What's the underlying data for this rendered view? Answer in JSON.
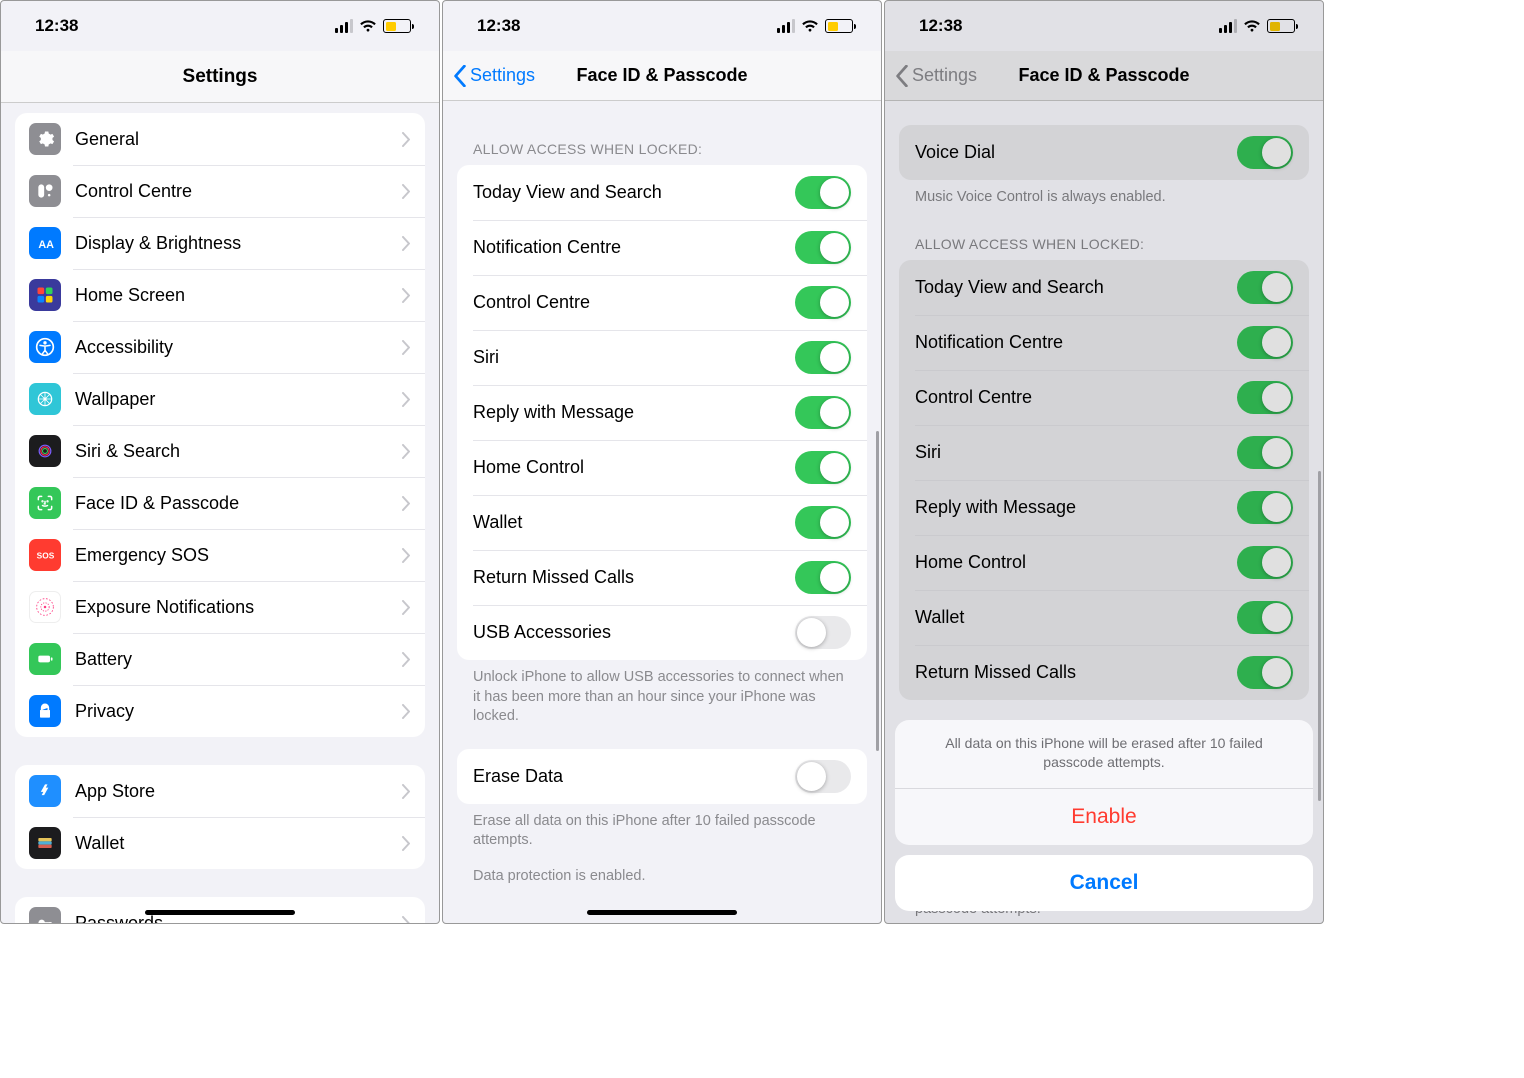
{
  "status": {
    "time": "12:38"
  },
  "screen1": {
    "title": "Settings",
    "group1": [
      {
        "label": "General",
        "name": "general",
        "color": "#8e8e93"
      },
      {
        "label": "Control Centre",
        "name": "control-centre",
        "color": "#8e8e93"
      },
      {
        "label": "Display & Brightness",
        "name": "display-brightness",
        "color": "#007aff"
      },
      {
        "label": "Home Screen",
        "name": "home-screen",
        "color": "#3a3a9c"
      },
      {
        "label": "Accessibility",
        "name": "accessibility",
        "color": "#007aff"
      },
      {
        "label": "Wallpaper",
        "name": "wallpaper",
        "color": "#2fc6d7"
      },
      {
        "label": "Siri & Search",
        "name": "siri-search",
        "color": "#1c1c1e"
      },
      {
        "label": "Face ID & Passcode",
        "name": "faceid-passcode",
        "color": "#34c759"
      },
      {
        "label": "Emergency SOS",
        "name": "emergency-sos",
        "color": "#ff3b30"
      },
      {
        "label": "Exposure Notifications",
        "name": "exposure-notifications",
        "color": "#ffffff"
      },
      {
        "label": "Battery",
        "name": "battery",
        "color": "#34c759"
      },
      {
        "label": "Privacy",
        "name": "privacy",
        "color": "#007aff"
      }
    ],
    "group2": [
      {
        "label": "App Store",
        "name": "app-store",
        "color": "#1f8fff"
      },
      {
        "label": "Wallet",
        "name": "wallet",
        "color": "#1c1c1e"
      }
    ],
    "group3": [
      {
        "label": "Passwords",
        "name": "passwords",
        "color": "#8e8e93"
      }
    ]
  },
  "screen2": {
    "back": "Settings",
    "title": "Face ID & Passcode",
    "truncated_top": " ",
    "section_header": "ALLOW ACCESS WHEN LOCKED:",
    "toggles": [
      {
        "label": "Today View and Search",
        "on": true,
        "name": "today-view"
      },
      {
        "label": "Notification Centre",
        "on": true,
        "name": "notification-centre"
      },
      {
        "label": "Control Centre",
        "on": true,
        "name": "control-centre"
      },
      {
        "label": "Siri",
        "on": true,
        "name": "siri"
      },
      {
        "label": "Reply with Message",
        "on": true,
        "name": "reply-message"
      },
      {
        "label": "Home Control",
        "on": true,
        "name": "home-control"
      },
      {
        "label": "Wallet",
        "on": true,
        "name": "wallet"
      },
      {
        "label": "Return Missed Calls",
        "on": true,
        "name": "return-missed"
      },
      {
        "label": "USB Accessories",
        "on": false,
        "name": "usb-accessories"
      }
    ],
    "usb_footer": "Unlock iPhone to allow USB accessories to connect when it has been more than an hour since your iPhone was locked.",
    "erase": {
      "label": "Erase Data",
      "on": false
    },
    "erase_footer1": "Erase all data on this iPhone after 10 failed passcode attempts.",
    "erase_footer2": "Data protection is enabled."
  },
  "screen3": {
    "back": "Settings",
    "title": "Face ID & Passcode",
    "voice_dial": {
      "label": "Voice Dial",
      "on": true
    },
    "voice_footer": "Music Voice Control is always enabled.",
    "section_header": "ALLOW ACCESS WHEN LOCKED:",
    "toggles": [
      {
        "label": "Today View and Search",
        "on": true,
        "name": "today-view"
      },
      {
        "label": "Notification Centre",
        "on": true,
        "name": "notification-centre"
      },
      {
        "label": "Control Centre",
        "on": true,
        "name": "control-centre"
      },
      {
        "label": "Siri",
        "on": true,
        "name": "siri"
      },
      {
        "label": "Reply with Message",
        "on": true,
        "name": "reply-message"
      },
      {
        "label": "Home Control",
        "on": true,
        "name": "home-control"
      },
      {
        "label": "Wallet",
        "on": true,
        "name": "wallet"
      },
      {
        "label": "Return Missed Calls",
        "on": true,
        "name": "return-missed"
      }
    ],
    "partial_footer": "passcode attempts.",
    "sheet": {
      "message": "All data on this iPhone will be erased after 10 failed passcode attempts.",
      "enable": "Enable",
      "cancel": "Cancel"
    }
  }
}
